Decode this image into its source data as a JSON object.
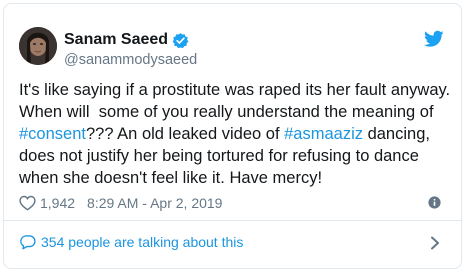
{
  "tweet": {
    "author_name": "Sanam Saeed",
    "handle": "@sanammodysaeed",
    "text_lines": [
      [
        {
          "text": "It's like saying if a prostitute was raped its her fault anyway."
        }
      ],
      [
        {
          "text": "When will  some of you really understand the meaning of"
        }
      ],
      [
        {
          "text": "#consent",
          "hashtag": true
        },
        {
          "text": "??? An old leaked video of "
        },
        {
          "text": "#asmaaziz",
          "hashtag": true
        },
        {
          "text": " dancing,"
        }
      ],
      [
        {
          "text": "does not justify her being tortured for refusing to dance"
        }
      ],
      [
        {
          "text": "when she doesn't feel like it. Have mercy!"
        }
      ]
    ],
    "like_count": "1,942",
    "timestamp": "8:29 AM - Apr 2, 2019",
    "talking_text": "354 people are talking about this"
  },
  "colors": {
    "text": "#14171a",
    "secondary": "#657786",
    "link": "#1b95e0",
    "verified": "#1da1f2",
    "border": "#e1e8ed"
  },
  "icons": {
    "verified": "verified-badge-icon",
    "brand": "twitter-bird-icon",
    "like": "heart-icon",
    "info": "info-icon",
    "reply": "speech-bubble-icon",
    "more": "chevron-right-icon"
  }
}
